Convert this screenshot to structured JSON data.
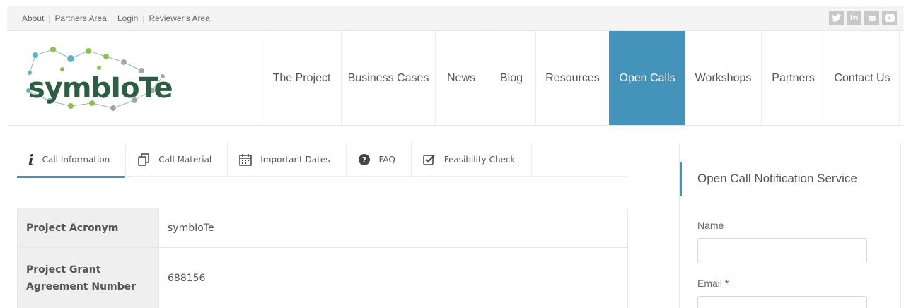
{
  "topbar": {
    "links": [
      "About",
      "Partners Area",
      "Login",
      "Reviewer's Area"
    ],
    "social": [
      "twitter-icon",
      "linkedin-icon",
      "github-icon",
      "youtube-icon"
    ]
  },
  "header": {
    "logo_text": "symbIoTe",
    "nav": [
      "The Project",
      "Business Cases",
      "News",
      "Blog",
      "Resources",
      "Open Calls",
      "Workshops",
      "Partners",
      "Contact Us"
    ],
    "active": "Open Calls",
    "accent": "#4393bb"
  },
  "tabs": [
    {
      "label": "Call Information",
      "icon": "info-icon"
    },
    {
      "label": "Call Material",
      "icon": "documents-icon"
    },
    {
      "label": "Important Dates",
      "icon": "calendar-icon"
    },
    {
      "label": "FAQ",
      "icon": "question-icon"
    },
    {
      "label": "Feasibility Check",
      "icon": "checkbox-icon"
    }
  ],
  "info_table": [
    {
      "key": "Project Acronym",
      "value": "symbIoTe"
    },
    {
      "key": "Project Grant Agreement Number",
      "value": "688156"
    }
  ],
  "sidebar": {
    "title": "Open Call Notification Service",
    "name_label": "Name",
    "email_label": "Email",
    "required_mark": "*"
  }
}
